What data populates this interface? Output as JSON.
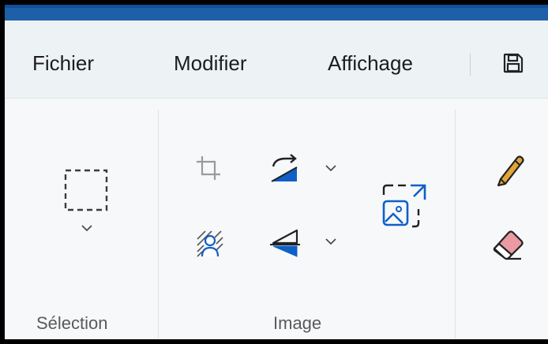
{
  "menu": {
    "file": "Fichier",
    "edit": "Modifier",
    "view": "Affichage"
  },
  "toolbar": {
    "save_icon": "floppy-disk-icon"
  },
  "groups": {
    "selection": {
      "label": "Sélection",
      "tool_icon": "rectangle-select-icon"
    },
    "image": {
      "label": "Image",
      "tools": [
        "crop-icon",
        "rotate-icon",
        "flip-icon",
        "remove-background-icon",
        "resize-icon"
      ]
    },
    "tools": {
      "items": [
        "pencil-icon",
        "eraser-icon"
      ]
    }
  },
  "colors": {
    "accent_blue": "#0f5fc7",
    "pencil": "#e0a53a",
    "eraser": "#e99aa2",
    "titlebar": "#1f5fa8"
  }
}
